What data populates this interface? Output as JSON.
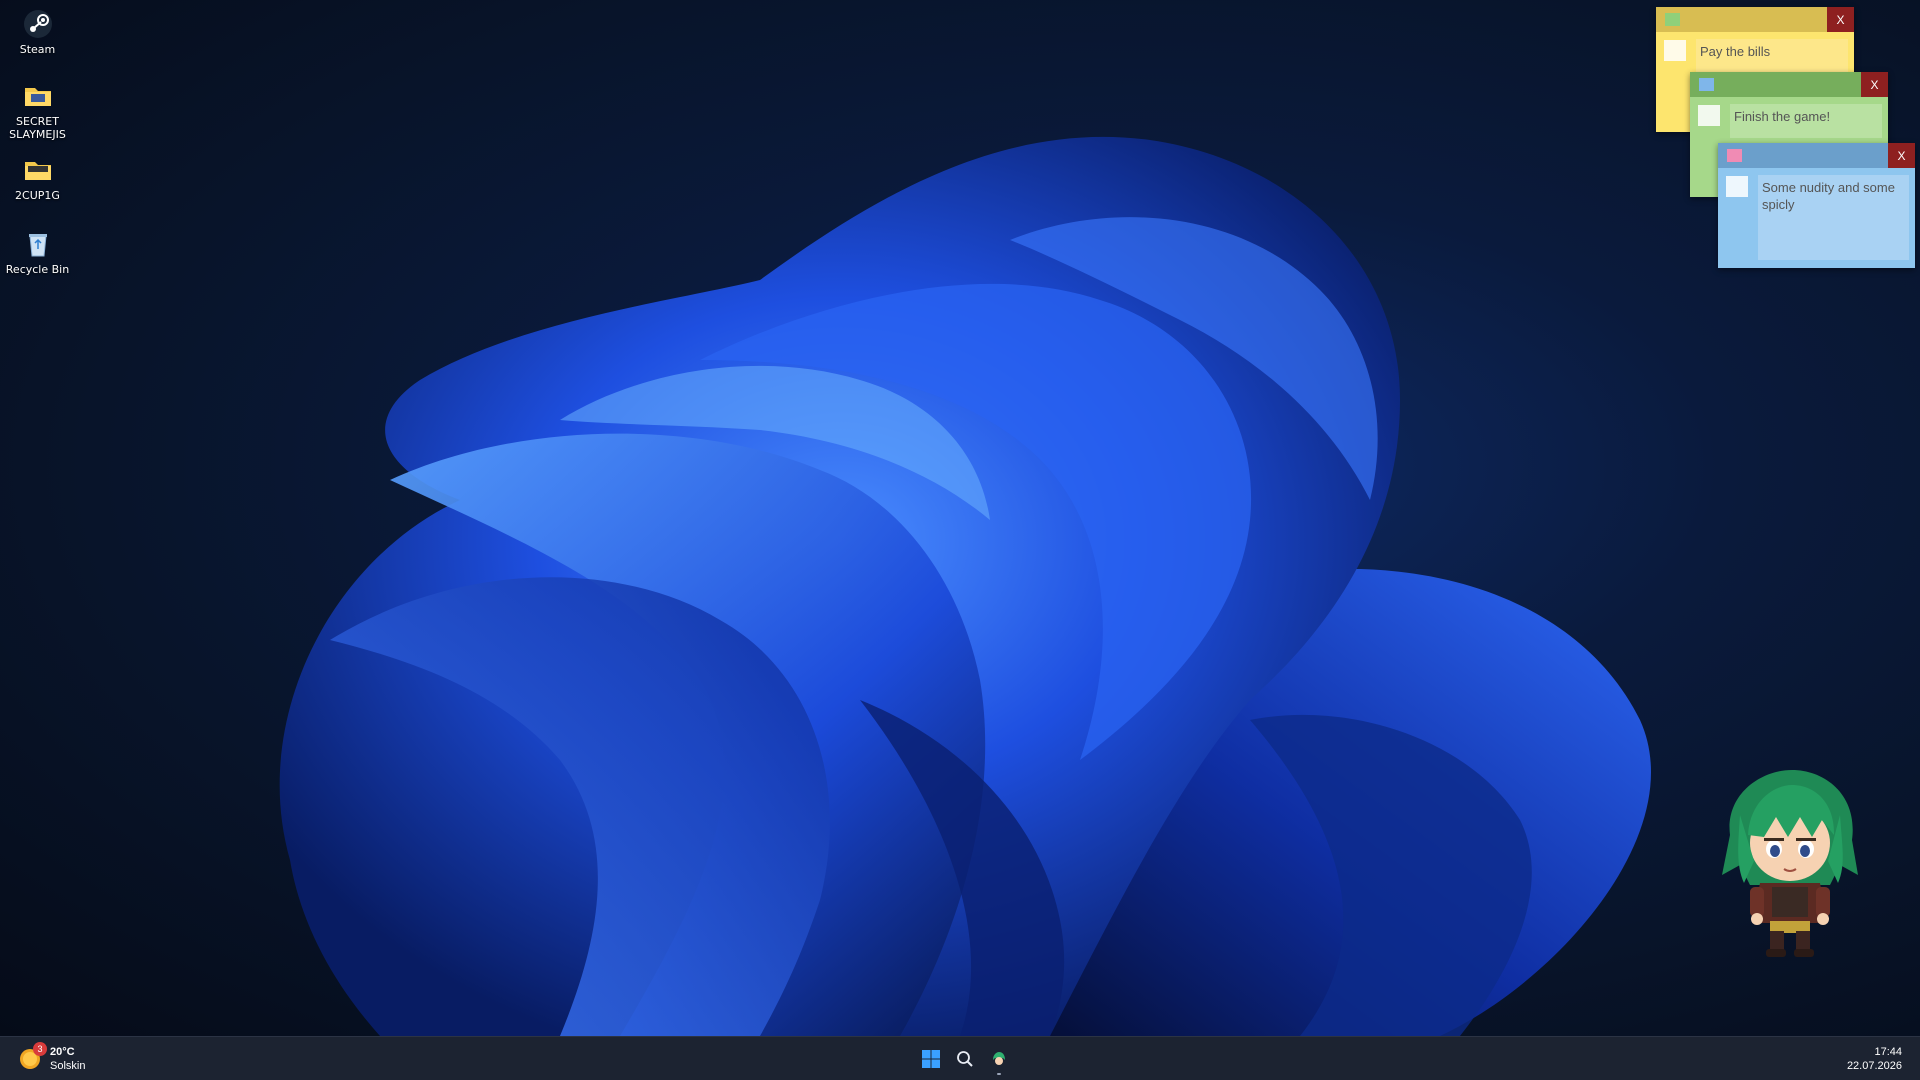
{
  "desktop_icons": [
    {
      "label": "Steam",
      "icon": "steam-icon"
    },
    {
      "label": "SECRET\nSLAYMEJIS",
      "icon": "folder-icon"
    },
    {
      "label": "2CUP1G",
      "icon": "folder-icon"
    },
    {
      "label": "Recycle Bin",
      "icon": "recycle-bin-icon"
    }
  ],
  "notes": [
    {
      "text": "Pay the bills",
      "color": "#fde56e",
      "swatch": "#8fd07a"
    },
    {
      "text": "Finish the game!",
      "color": "#a6d88a",
      "swatch": "#7fb6ea"
    },
    {
      "text": "Some nudity and some spicly",
      "color": "#8ec6ef",
      "swatch": "#f08bb4"
    }
  ],
  "note_close_label": "X",
  "taskbar": {
    "weather": {
      "temp": "20°C",
      "condition": "Solskin",
      "badge": "3"
    },
    "icons": [
      "windows-start-icon",
      "search-icon",
      "mascot-app-icon"
    ],
    "time": "17:44",
    "date": "22.07.2026"
  },
  "colors": {
    "accent": "#1f5bff",
    "taskbar": "#1c2331",
    "close": "#8e2020"
  }
}
